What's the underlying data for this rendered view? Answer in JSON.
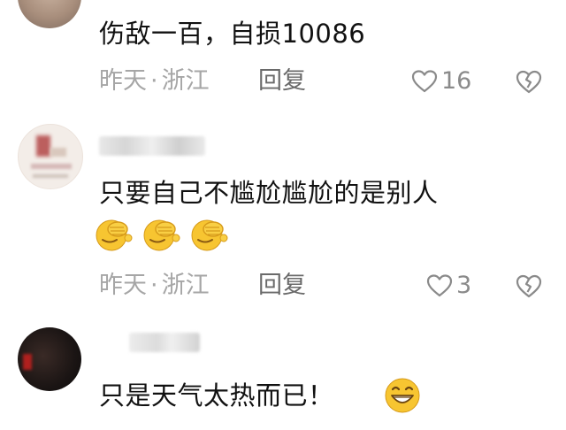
{
  "comments": [
    {
      "text": "伤敌一百，自损10086",
      "time": "昨天",
      "separator": "·",
      "location": "浙江",
      "reply_label": "回复",
      "likes": "16",
      "avatar_icon": "avatar-icon"
    },
    {
      "text": "只要自己不尴尬尴尬的是别人",
      "emojis": [
        "facepalm-emoji",
        "facepalm-emoji",
        "facepalm-emoji"
      ],
      "time": "昨天",
      "separator": "·",
      "location": "浙江",
      "reply_label": "回复",
      "likes": "3",
      "avatar_icon": "avatar-icon"
    },
    {
      "text": "只是天气太热而已！",
      "emojis": [
        "grin-emoji"
      ],
      "avatar_icon": "avatar-icon"
    }
  ],
  "icons": {
    "like": "heart-outline-icon",
    "dislike": "broken-heart-icon"
  },
  "colors": {
    "meta_text": "#a6a6a6",
    "reply_text": "#6a6a6a",
    "emoji_yellow": "#f7c531"
  }
}
